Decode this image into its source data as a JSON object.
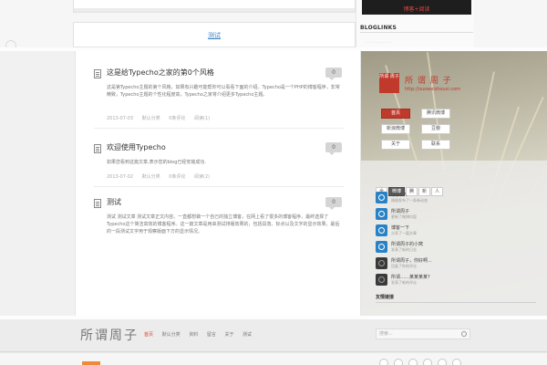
{
  "top_section": {
    "more_link": "测试",
    "banner_text": "博客+阅读",
    "bloglinks_title": "BLOGLINKS",
    "bloglinks_items": "· · · · · · · · · ·"
  },
  "posts": [
    {
      "title": "这是给Typecho之家的第0个风格",
      "comments": "0",
      "body": "这是第Typecho主题的第个风格，如果有兴趣可能帮你可以看看下面的介绍。Typecho是一个PHP的博客程序，非常精致，Typecho主题的个性化程度高，Typecho之家将介绍更多Typecho主题。",
      "meta": [
        "2013-07-03",
        "默认分类",
        "0条评论",
        "阅读(1)"
      ]
    },
    {
      "title": "欢迎使用Typecho",
      "comments": "0",
      "body": "如果您看到这篇文章,表示您的blog已经安装成功.",
      "meta": [
        "2013-07-02",
        "默认分类",
        "0条评论",
        "阅读(2)"
      ]
    },
    {
      "title": "测试",
      "comments": "0",
      "body": "测试 测试文章 测试文章正文内容。一直都想做一个自己的独立博客，在网上看了很多的博客程序，最终选择了Typecho这个简洁高效的博客程序。这一篇文章是用来测试排版效果的，包括段落、标点以及文字的显示效果。最后的一段测试文字用于观察版面下方的显示情况。",
      "meta": []
    }
  ],
  "profile": {
    "logo_text": "所谓 周子",
    "brand_name": "所 谓 周 子",
    "brand_url": "http://suoweizhouzi.com",
    "buttons": [
      "首页",
      "腾讯微博",
      "新浪微博",
      "豆瓣",
      "关于",
      "联系"
    ],
    "tabs": [
      "全",
      "微博",
      "腾",
      "新",
      "人"
    ],
    "feed": [
      {
        "name": "QQ个人",
        "sub": "刚刚发布了一条新动态"
      },
      {
        "name": "所谓周子",
        "sub": "更新了微博内容"
      },
      {
        "name": "博客一下",
        "sub": "分享了一篇文章"
      },
      {
        "name": "所谓周子的小窝",
        "sub": "发表了新的日志"
      },
      {
        "name": "所谓周子，你好啊...",
        "sub": "回复了你的评论"
      },
      {
        "name": "所谓……某某某某?",
        "sub": "发表了新的评论"
      }
    ],
    "friends_title": "友情链接"
  },
  "bottom": {
    "site_title": "所谓周子",
    "nav": [
      "首页",
      "默认分类",
      "资料",
      "留言",
      "关于",
      "测试"
    ],
    "search_placeholder": "搜索..."
  },
  "colors": {
    "accent_red": "#c0392b",
    "link_blue": "#3f86c8",
    "feed_blue": "#2a82c6",
    "nav_active": "#d8452e"
  }
}
